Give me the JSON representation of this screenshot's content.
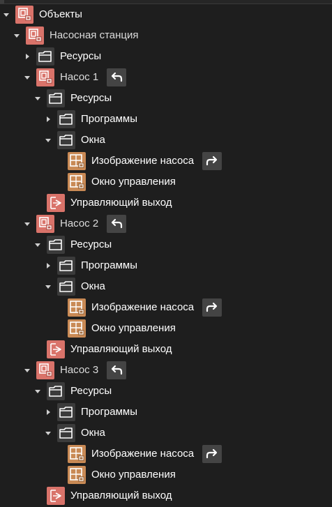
{
  "colors": {
    "background": "#1e1e1e",
    "object_icon": "#d9736a",
    "window_icon": "#c98a55",
    "folder_icon_bg": "#3b3b3b",
    "action_button": "#444444"
  },
  "tree": [
    {
      "label": "Объекты",
      "level": 0,
      "icon": "object-icon",
      "expander": "expanded"
    },
    {
      "label": "Насосная станция",
      "level": 1,
      "icon": "object-icon",
      "expander": "expanded",
      "muted": true
    },
    {
      "label": "Ресурсы",
      "level": 2,
      "icon": "folder-icon",
      "expander": "collapsed"
    },
    {
      "label": "Насос 1",
      "level": 2,
      "icon": "object-icon",
      "expander": "expanded",
      "action": "undo-arrow-icon",
      "muted": true
    },
    {
      "label": "Ресурсы",
      "level": 3,
      "icon": "folder-icon",
      "expander": "expanded"
    },
    {
      "label": "Программы",
      "level": 4,
      "icon": "folder-icon",
      "expander": "collapsed"
    },
    {
      "label": "Окна",
      "level": 4,
      "icon": "folder-icon",
      "expander": "expanded"
    },
    {
      "label": "Изображение насоса",
      "level": 5,
      "icon": "window-icon",
      "expander": "none",
      "action": "redo-arrow-icon"
    },
    {
      "label": "Окно управления",
      "level": 5,
      "icon": "window-icon",
      "expander": "none"
    },
    {
      "label": "Управляющий выход",
      "level": 3,
      "icon": "output-icon",
      "expander": "none"
    },
    {
      "label": "Насос 2",
      "level": 2,
      "icon": "object-icon",
      "expander": "expanded",
      "action": "undo-arrow-icon",
      "muted": true
    },
    {
      "label": "Ресурсы",
      "level": 3,
      "icon": "folder-icon",
      "expander": "expanded"
    },
    {
      "label": "Программы",
      "level": 4,
      "icon": "folder-icon",
      "expander": "collapsed"
    },
    {
      "label": "Окна",
      "level": 4,
      "icon": "folder-icon",
      "expander": "expanded"
    },
    {
      "label": "Изображение насоса",
      "level": 5,
      "icon": "window-icon",
      "expander": "none",
      "action": "redo-arrow-icon"
    },
    {
      "label": "Окно управления",
      "level": 5,
      "icon": "window-icon",
      "expander": "none"
    },
    {
      "label": "Управляющий выход",
      "level": 3,
      "icon": "output-icon",
      "expander": "none"
    },
    {
      "label": "Насос 3",
      "level": 2,
      "icon": "object-icon",
      "expander": "expanded",
      "action": "undo-arrow-icon",
      "muted": true
    },
    {
      "label": "Ресурсы",
      "level": 3,
      "icon": "folder-icon",
      "expander": "expanded"
    },
    {
      "label": "Программы",
      "level": 4,
      "icon": "folder-icon",
      "expander": "collapsed"
    },
    {
      "label": "Окна",
      "level": 4,
      "icon": "folder-icon",
      "expander": "expanded"
    },
    {
      "label": "Изображение насоса",
      "level": 5,
      "icon": "window-icon",
      "expander": "none",
      "action": "redo-arrow-icon"
    },
    {
      "label": "Окно управления",
      "level": 5,
      "icon": "window-icon",
      "expander": "none"
    },
    {
      "label": "Управляющий выход",
      "level": 3,
      "icon": "output-icon",
      "expander": "none"
    }
  ]
}
